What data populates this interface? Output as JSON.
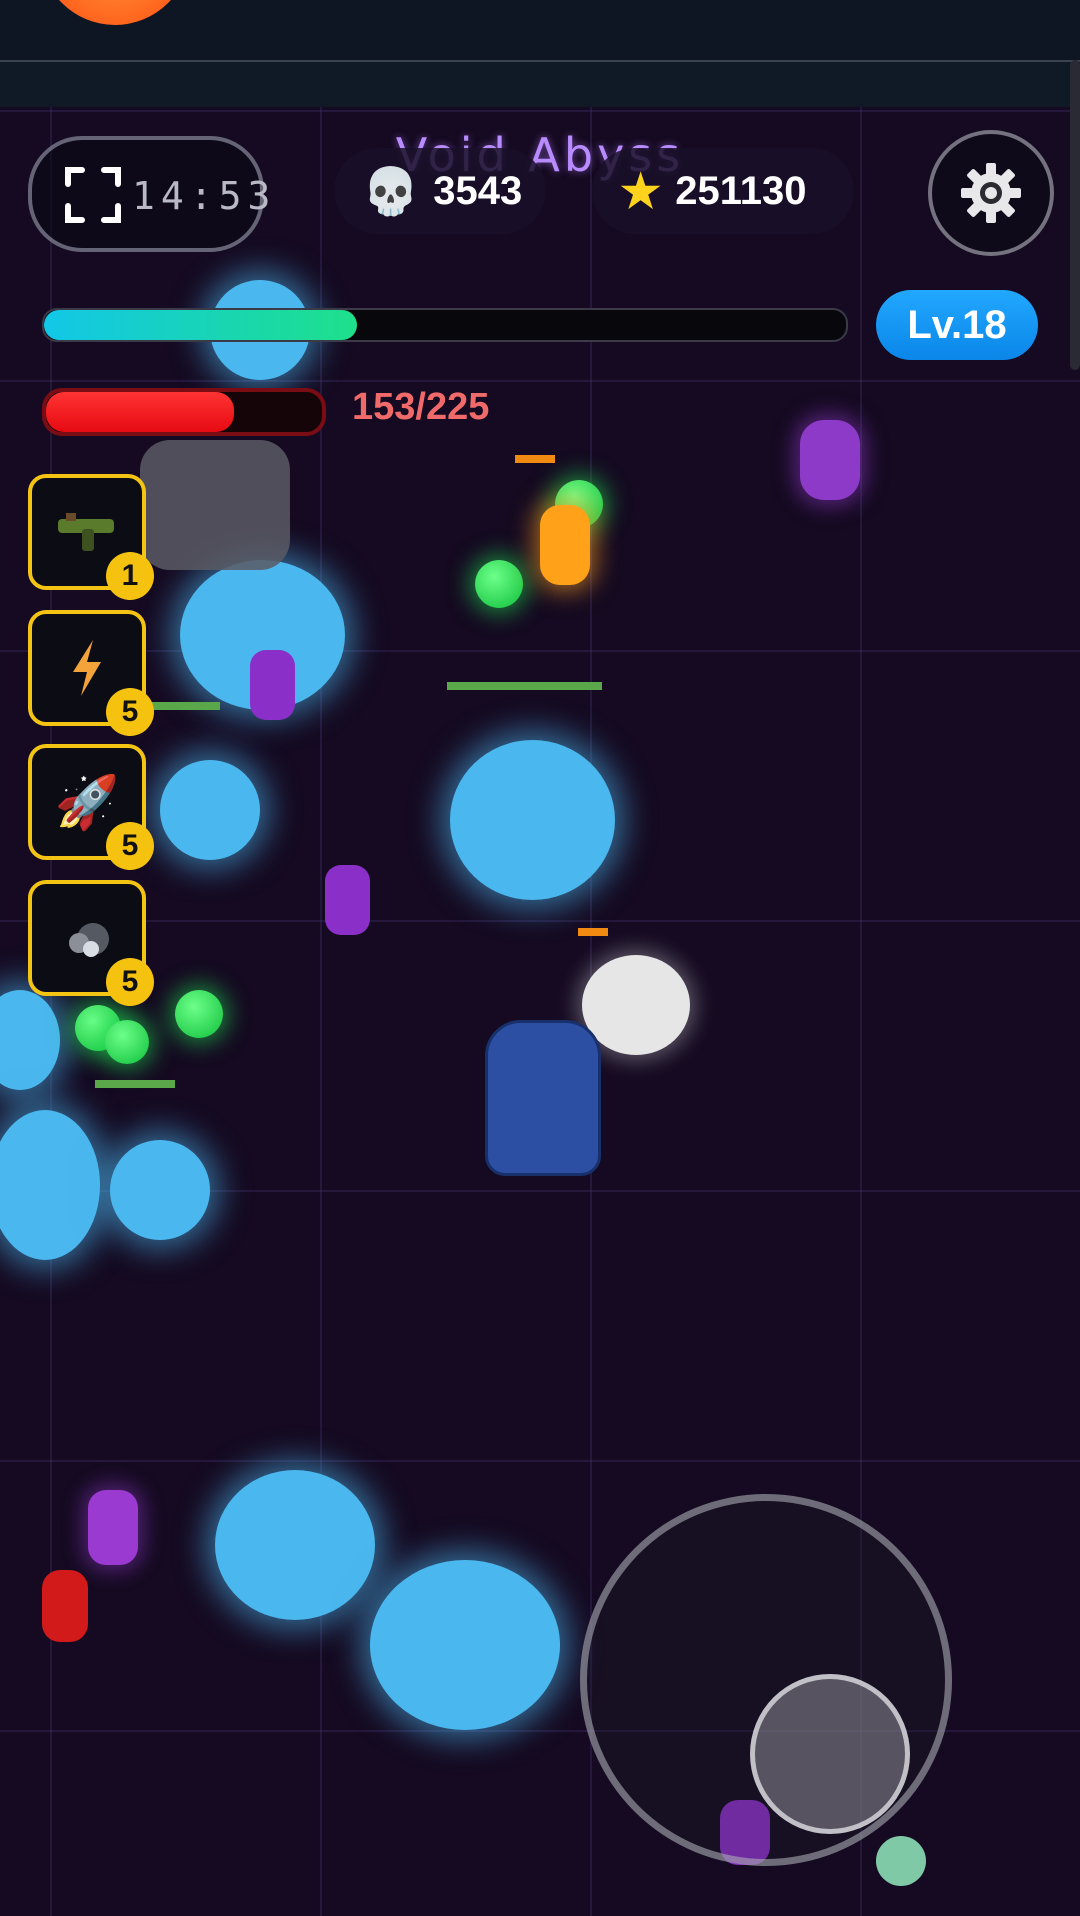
{
  "hud": {
    "title": "Void Abyss",
    "timer": "14:53",
    "kills": "3543",
    "score": "251130",
    "level": "Lv.18",
    "xp_progress": 0.39,
    "hp_text": "153/225",
    "hp_current": 153,
    "hp_max": 225
  },
  "icons": {
    "timer": "focus-frame-icon",
    "kills": "skull-icon",
    "score": "star-icon",
    "settings": "gear-icon"
  },
  "skills": [
    {
      "icon": "gun-icon",
      "level": "1"
    },
    {
      "icon": "lightning-icon",
      "level": "5"
    },
    {
      "icon": "rocket-icon",
      "level": "5"
    },
    {
      "icon": "smoke-bomb-icon",
      "level": "5"
    }
  ],
  "colors": {
    "accent_title": "#b88cff",
    "xp_gradient_start": "#12c7e8",
    "xp_gradient_end": "#1ee08a",
    "hp": "#ff2a2a",
    "level_badge": "#1a9cf5",
    "skill_border": "#f4c414"
  }
}
